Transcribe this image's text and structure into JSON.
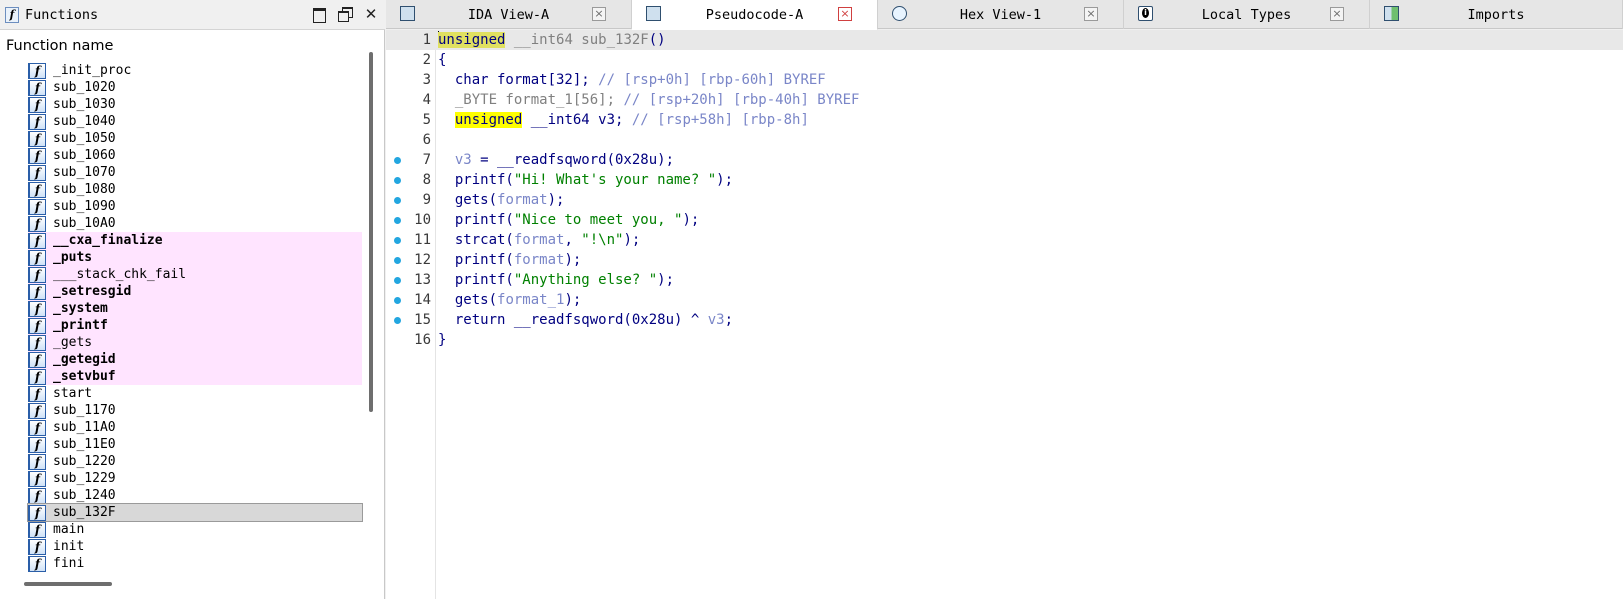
{
  "functions_panel": {
    "title": "Functions",
    "column_header": "Function name",
    "items": [
      {
        "name": "_init_proc",
        "style": "normal"
      },
      {
        "name": "sub_1020",
        "style": "normal"
      },
      {
        "name": "sub_1030",
        "style": "normal"
      },
      {
        "name": "sub_1040",
        "style": "normal"
      },
      {
        "name": "sub_1050",
        "style": "normal"
      },
      {
        "name": "sub_1060",
        "style": "normal"
      },
      {
        "name": "sub_1070",
        "style": "normal"
      },
      {
        "name": "sub_1080",
        "style": "normal"
      },
      {
        "name": "sub_1090",
        "style": "normal"
      },
      {
        "name": "sub_10A0",
        "style": "normal"
      },
      {
        "name": "__cxa_finalize",
        "style": "lib"
      },
      {
        "name": "_puts",
        "style": "lib"
      },
      {
        "name": "___stack_chk_fail",
        "style": "lib-plain"
      },
      {
        "name": "_setresgid",
        "style": "lib"
      },
      {
        "name": "_system",
        "style": "lib"
      },
      {
        "name": "_printf",
        "style": "lib"
      },
      {
        "name": "_gets",
        "style": "lib-plain"
      },
      {
        "name": "_getegid",
        "style": "lib"
      },
      {
        "name": "_setvbuf",
        "style": "lib"
      },
      {
        "name": "start",
        "style": "normal"
      },
      {
        "name": "sub_1170",
        "style": "normal"
      },
      {
        "name": "sub_11A0",
        "style": "normal"
      },
      {
        "name": "sub_11E0",
        "style": "normal"
      },
      {
        "name": "sub_1220",
        "style": "normal"
      },
      {
        "name": "sub_1229",
        "style": "normal"
      },
      {
        "name": "sub_1240",
        "style": "normal"
      },
      {
        "name": "sub_132F",
        "style": "selected"
      },
      {
        "name": "main",
        "style": "normal"
      },
      {
        "name": "init",
        "style": "normal"
      },
      {
        "name": "fini",
        "style": "normal"
      }
    ]
  },
  "tabs": [
    {
      "label": "IDA View-A",
      "icon": "ida-view-icon",
      "active": false
    },
    {
      "label": "Pseudocode-A",
      "icon": "pseudocode-icon",
      "active": true
    },
    {
      "label": "Hex View-1",
      "icon": "hex-view-icon",
      "active": false
    },
    {
      "label": "Local Types",
      "icon": "local-types-icon",
      "active": false
    },
    {
      "label": "Imports",
      "icon": "imports-icon",
      "active": false
    }
  ],
  "code": {
    "lines": [
      {
        "n": "1",
        "dot": false,
        "tokens": [
          [
            "hl-cur",
            "unsigned"
          ],
          [
            "gray",
            " __int64 sub_132F"
          ],
          [
            "kw",
            "()"
          ]
        ]
      },
      {
        "n": "2",
        "dot": false,
        "tokens": [
          [
            "kw",
            "{"
          ]
        ]
      },
      {
        "n": "3",
        "dot": false,
        "tokens": [
          [
            "kw",
            "  char format[32]; "
          ],
          [
            "cmt",
            "// [rsp+0h] [rbp-60h] BYREF"
          ]
        ]
      },
      {
        "n": "4",
        "dot": false,
        "tokens": [
          [
            "gray",
            "  _BYTE format_1[56]; "
          ],
          [
            "cmt",
            "// [rsp+20h] [rbp-40h] BYREF"
          ]
        ]
      },
      {
        "n": "5",
        "dot": false,
        "tokens": [
          [
            "plain",
            "  "
          ],
          [
            "hl",
            "unsigned"
          ],
          [
            "kw",
            " __int64 v3; "
          ],
          [
            "cmt",
            "// [rsp+58h] [rbp-8h]"
          ]
        ]
      },
      {
        "n": "6",
        "dot": false,
        "tokens": []
      },
      {
        "n": "7",
        "dot": true,
        "tokens": [
          [
            "var",
            "  v3"
          ],
          [
            "kw",
            " = __readfsqword(0x28u);"
          ]
        ]
      },
      {
        "n": "8",
        "dot": true,
        "tokens": [
          [
            "kw",
            "  printf("
          ],
          [
            "str",
            "\"Hi! What's your name? \""
          ],
          [
            "kw",
            ");"
          ]
        ]
      },
      {
        "n": "9",
        "dot": true,
        "tokens": [
          [
            "kw",
            "  gets("
          ],
          [
            "var",
            "format"
          ],
          [
            "kw",
            ");"
          ]
        ]
      },
      {
        "n": "10",
        "dot": true,
        "tokens": [
          [
            "kw",
            "  printf("
          ],
          [
            "str",
            "\"Nice to meet you, \""
          ],
          [
            "kw",
            ");"
          ]
        ]
      },
      {
        "n": "11",
        "dot": true,
        "tokens": [
          [
            "kw",
            "  strcat("
          ],
          [
            "var",
            "format"
          ],
          [
            "kw",
            ", "
          ],
          [
            "str",
            "\"!\\n\""
          ],
          [
            "kw",
            ");"
          ]
        ]
      },
      {
        "n": "12",
        "dot": true,
        "tokens": [
          [
            "kw",
            "  printf("
          ],
          [
            "var",
            "format"
          ],
          [
            "kw",
            ");"
          ]
        ]
      },
      {
        "n": "13",
        "dot": true,
        "tokens": [
          [
            "kw",
            "  printf("
          ],
          [
            "str",
            "\"Anything else? \""
          ],
          [
            "kw",
            ");"
          ]
        ]
      },
      {
        "n": "14",
        "dot": true,
        "tokens": [
          [
            "kw",
            "  gets("
          ],
          [
            "var",
            "format_1"
          ],
          [
            "kw",
            ");"
          ]
        ]
      },
      {
        "n": "15",
        "dot": true,
        "tokens": [
          [
            "kw",
            "  return __readfsqword(0x28u) ^ "
          ],
          [
            "var",
            "v3"
          ],
          [
            "kw",
            ";"
          ]
        ]
      },
      {
        "n": "16",
        "dot": false,
        "tokens": [
          [
            "kw",
            "}"
          ]
        ]
      }
    ]
  },
  "colors": {
    "lib_function_bg": "#ffe4ff",
    "keyword": "#000080",
    "string": "#008000",
    "comment": "#7a86c8",
    "highlight": "#ffff00",
    "breakpoint_dot": "#22a6e0"
  }
}
